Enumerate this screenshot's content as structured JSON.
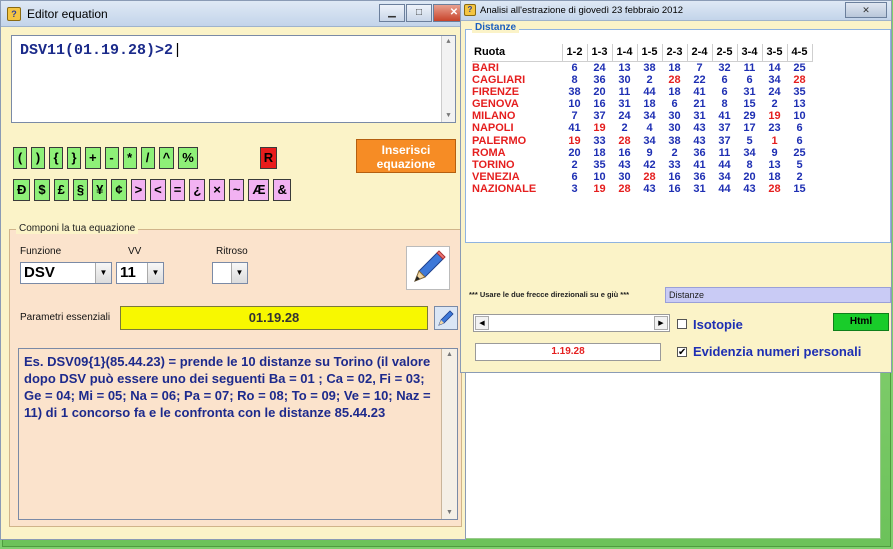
{
  "editor": {
    "title": "Editor equation",
    "equation": "DSV11(01.19.28)>2",
    "keys_row1": [
      "(",
      ")",
      "{",
      "}",
      "+",
      "-",
      "*",
      "/",
      "^",
      "%"
    ],
    "key_r": "R",
    "keys_row2": [
      "Ð",
      "$",
      "£",
      "§",
      "¥",
      "¢",
      ">",
      "<",
      "=",
      "¿",
      "×",
      "~",
      "Æ",
      "&"
    ],
    "insert_button": "Inserisci equazione",
    "group_title": "Componi la tua equazione",
    "funzione_label": "Funzione",
    "vv_label": "VV",
    "ritroso_label": "Ritroso",
    "funzione_value": "DSV",
    "vv_value": "11",
    "ritroso_value": "",
    "parametri_label": "Parametri essenziali",
    "parametri_value": "01.19.28",
    "description": "Es. DSV09{1}(85.44.23) = prende le 10 distanze su Torino  (il valore dopo DSV può essere uno dei seguenti  Ba = 01 ; Ca = 02, Fi = 03; Ge = 04; Mi = 05; Na = 06; Pa = 07; Ro = 08; To = 09; Ve = 10; Naz = 11) di 1 concorso fa e le confronta con le distanze 85.44.23"
  },
  "analysis": {
    "title": "Analisi all'estrazione di giovedì 23 febbraio 2012",
    "group_title": "Distanze",
    "columns": [
      "Ruota",
      "1-2",
      "1-3",
      "1-4",
      "1-5",
      "2-3",
      "2-4",
      "2-5",
      "3-4",
      "3-5",
      "4-5"
    ],
    "rows": [
      {
        "name": "BARI",
        "values": [
          "6",
          "24",
          "13",
          "38",
          "18",
          "7",
          "32",
          "11",
          "14",
          "25"
        ]
      },
      {
        "name": "CAGLIARI",
        "values": [
          "8",
          "36",
          "30",
          "2",
          "28",
          "22",
          "6",
          "6",
          "34",
          "28"
        ]
      },
      {
        "name": "FIRENZE",
        "values": [
          "38",
          "20",
          "11",
          "44",
          "18",
          "41",
          "6",
          "31",
          "24",
          "35"
        ]
      },
      {
        "name": "GENOVA",
        "values": [
          "10",
          "16",
          "31",
          "18",
          "6",
          "21",
          "8",
          "15",
          "2",
          "13"
        ]
      },
      {
        "name": "MILANO",
        "values": [
          "7",
          "37",
          "24",
          "34",
          "30",
          "31",
          "41",
          "29",
          "19",
          "10"
        ]
      },
      {
        "name": "NAPOLI",
        "values": [
          "41",
          "19",
          "2",
          "4",
          "30",
          "43",
          "37",
          "17",
          "23",
          "6"
        ]
      },
      {
        "name": "PALERMO",
        "values": [
          "19",
          "33",
          "28",
          "34",
          "38",
          "43",
          "37",
          "5",
          "1",
          "6"
        ]
      },
      {
        "name": "ROMA",
        "values": [
          "20",
          "18",
          "16",
          "9",
          "2",
          "36",
          "11",
          "34",
          "9",
          "25"
        ]
      },
      {
        "name": "TORINO",
        "values": [
          "2",
          "35",
          "43",
          "42",
          "33",
          "41",
          "44",
          "8",
          "13",
          "5"
        ]
      },
      {
        "name": "VENEZIA",
        "values": [
          "6",
          "10",
          "30",
          "28",
          "16",
          "36",
          "34",
          "20",
          "18",
          "2"
        ]
      },
      {
        "name": "NAZIONALE",
        "values": [
          "3",
          "19",
          "28",
          "43",
          "16",
          "31",
          "44",
          "43",
          "28",
          "15"
        ]
      }
    ],
    "highlight_numbers": [
      "1",
      "19",
      "28"
    ],
    "note": "*** Usare le due frecce direzionali su e giù ***",
    "note_field": "Distanze",
    "isotopie_label": "Isotopie",
    "isotopie_checked": false,
    "html_button": "Html",
    "numbers_field": "1.19.28",
    "evidenzia_label": "Evidenzia numeri personali",
    "evidenzia_checked": true
  },
  "colors": {
    "accent_red": "#e51f1f",
    "number_blue": "#1e2fb3",
    "insert_orange": "#f68c25",
    "param_yellow": "#f8f800",
    "html_green": "#19cc2a"
  }
}
